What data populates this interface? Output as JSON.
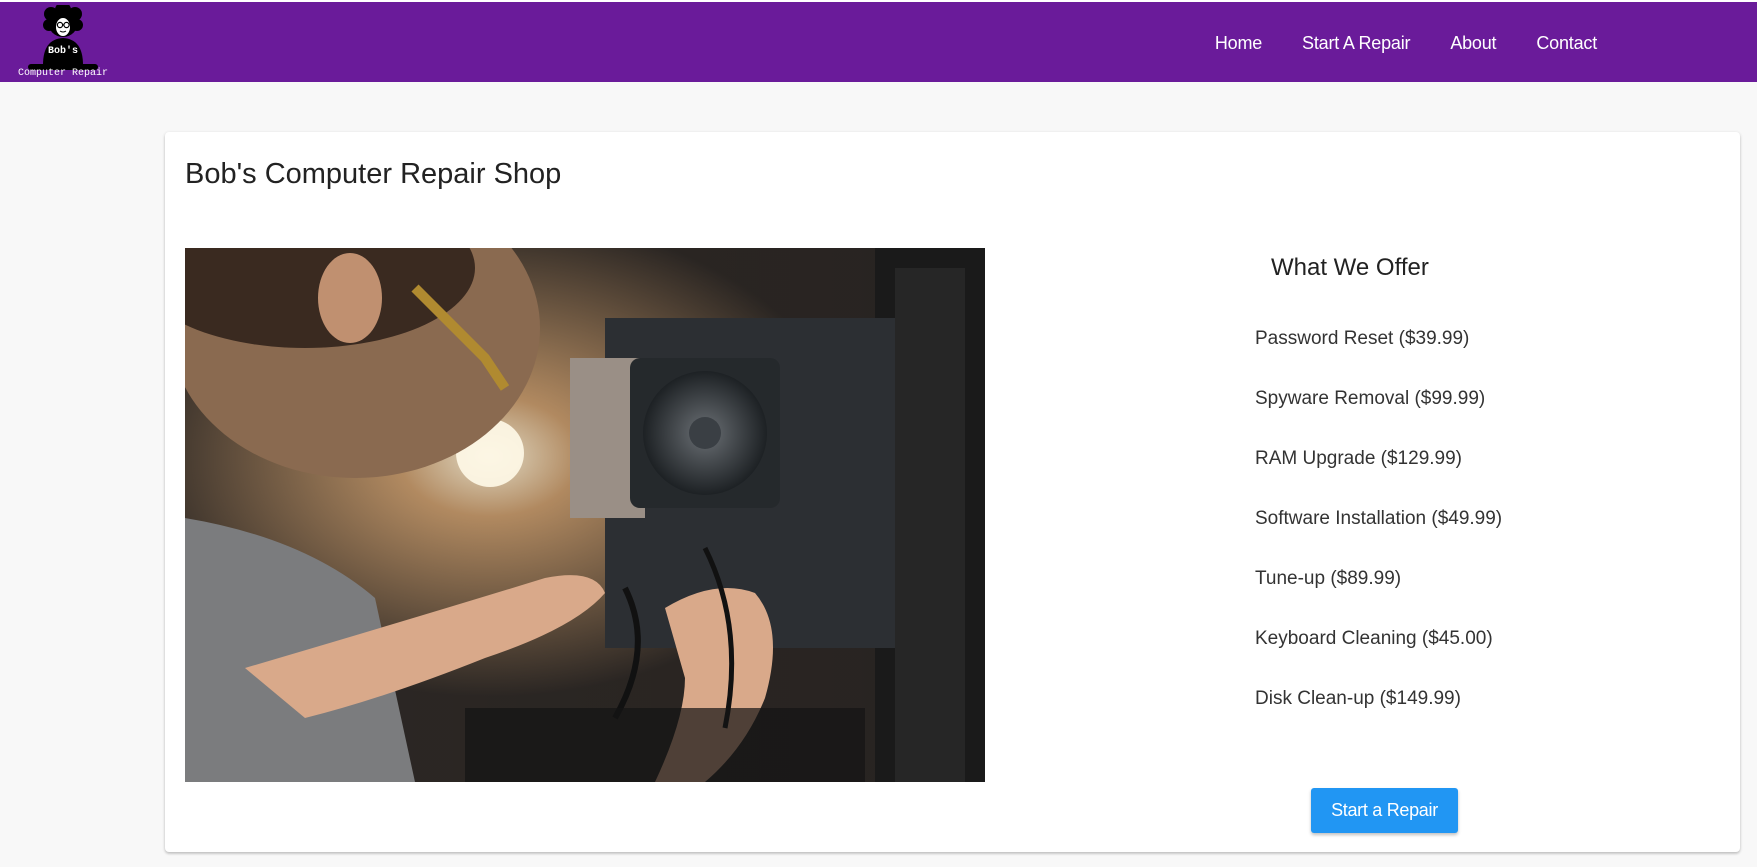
{
  "header": {
    "logo_line1": "Bob's",
    "logo_line2": "Computer Repair",
    "nav": [
      "Home",
      "Start A Repair",
      "About",
      "Contact"
    ],
    "background_color": "#6a1b9a"
  },
  "main": {
    "title": "Bob's Computer Repair Shop",
    "photo_icon": "technician-repairing-computer-image",
    "offers_title": "What We Offer",
    "offers": [
      "Password Reset ($39.99)",
      "Spyware Removal ($99.99)",
      "RAM Upgrade ($129.99)",
      "Software Installation ($49.99)",
      "Tune-up ($89.99)",
      "Keyboard Cleaning ($45.00)",
      "Disk Clean-up ($149.99)"
    ],
    "cta_label": "Start a Repair",
    "cta_color": "#2196f3"
  }
}
